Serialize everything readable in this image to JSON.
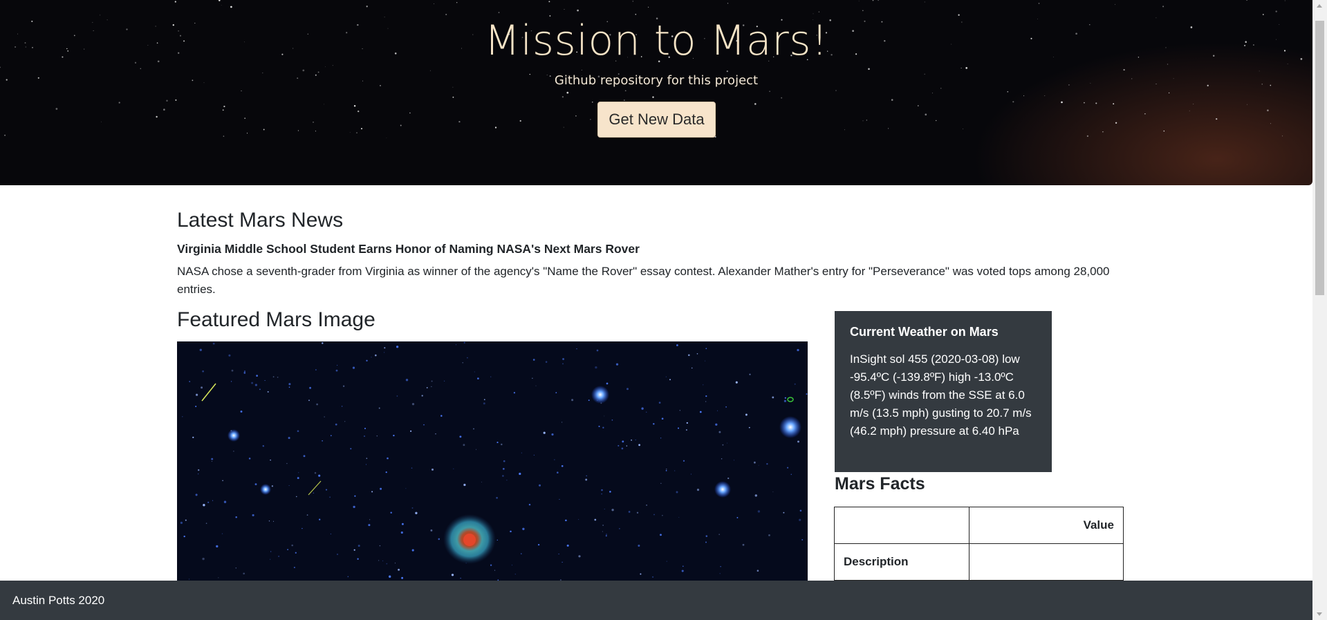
{
  "hero": {
    "title": "Mission to Mars!",
    "repo_link": "Github repository for this project",
    "button_label": "Get New Data"
  },
  "news": {
    "heading": "Latest Mars News",
    "title": "Virginia Middle School Student Earns Honor of Naming NASA's Next Mars Rover",
    "body": "NASA chose a seventh-grader from Virginia as winner of the agency's \"Name the Rover\" essay contest. Alexander Mather's entry for \"Perseverance\" was voted tops among 28,000 entries."
  },
  "featured_image": {
    "heading": "Featured Mars Image"
  },
  "weather": {
    "heading": "Current Weather on Mars",
    "text": "InSight sol 455 (2020-03-08) low -95.4ºC (-139.8ºF) high -13.0ºC (8.5ºF) winds from the SSE at 6.0 m/s (13.5 mph) gusting to 20.7 m/s (46.2 mph) pressure at 6.40 hPa"
  },
  "facts": {
    "heading": "Mars Facts",
    "columns": [
      "",
      "Value"
    ],
    "rows": [
      {
        "label": "Description",
        "value": ""
      }
    ]
  },
  "footer": {
    "text": "Austin Potts 2020"
  },
  "colors": {
    "dark_panel": "#343a40",
    "button_bg": "#f7e4cb",
    "hero_title": "#f5e3c6"
  }
}
